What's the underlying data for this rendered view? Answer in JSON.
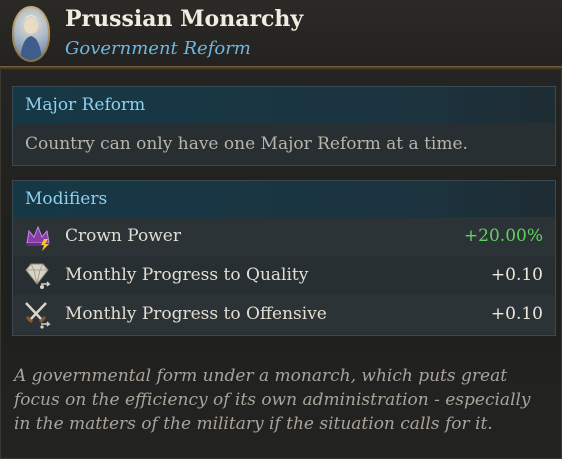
{
  "header": {
    "title": "Prussian Monarchy",
    "subtitle": "Government Reform",
    "portrait_icon": "monarch-portrait"
  },
  "major_reform": {
    "heading": "Major Reform",
    "text": "Country can only have one Major Reform at a time."
  },
  "modifiers": {
    "heading": "Modifiers",
    "items": [
      {
        "label": "Crown Power",
        "value": "+20.00%",
        "icon": "crown-power-icon",
        "tone": "positive"
      },
      {
        "label": "Monthly Progress to Quality",
        "value": "+0.10",
        "icon": "quality-diamond-icon",
        "tone": "neutral"
      },
      {
        "label": "Monthly Progress to Offensive",
        "value": "+0.10",
        "icon": "crossed-swords-icon",
        "tone": "neutral"
      }
    ]
  },
  "description": "A governmental form under a monarch, which puts great focus on the efficiency of its own administration - especially in the matters of the military if the situation calls for it.",
  "colors": {
    "accent_blue": "#6fb6e0",
    "positive_green": "#5fd35f",
    "header_gold": "#7a6640"
  }
}
